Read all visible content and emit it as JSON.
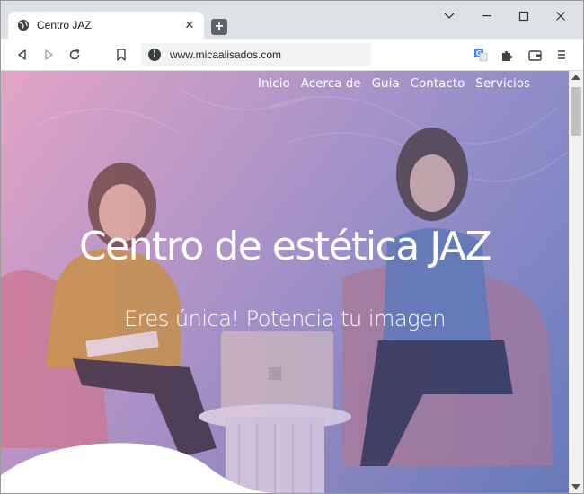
{
  "browser": {
    "tab": {
      "title": "Centro JAZ",
      "close": "✕",
      "favicon": "globe-icon"
    },
    "new_tab": "+",
    "window_controls": {
      "dropdown": "⌄",
      "minimize": "—",
      "maximize": "☐",
      "close": "✕"
    },
    "url": "www.micaalisados.com",
    "icons": [
      "back-icon",
      "forward-icon",
      "reload-icon",
      "bookmark-icon",
      "info-icon",
      "translate-icon",
      "extensions-icon",
      "wallet-icon",
      "menu-icon"
    ]
  },
  "site": {
    "nav": [
      "Inicio",
      "Acerca de",
      "Guia",
      "Contacto",
      "Servicios"
    ],
    "hero_title": "Centro de estética JAZ",
    "hero_subtitle": "Eres única! Potencia tu imagen"
  }
}
